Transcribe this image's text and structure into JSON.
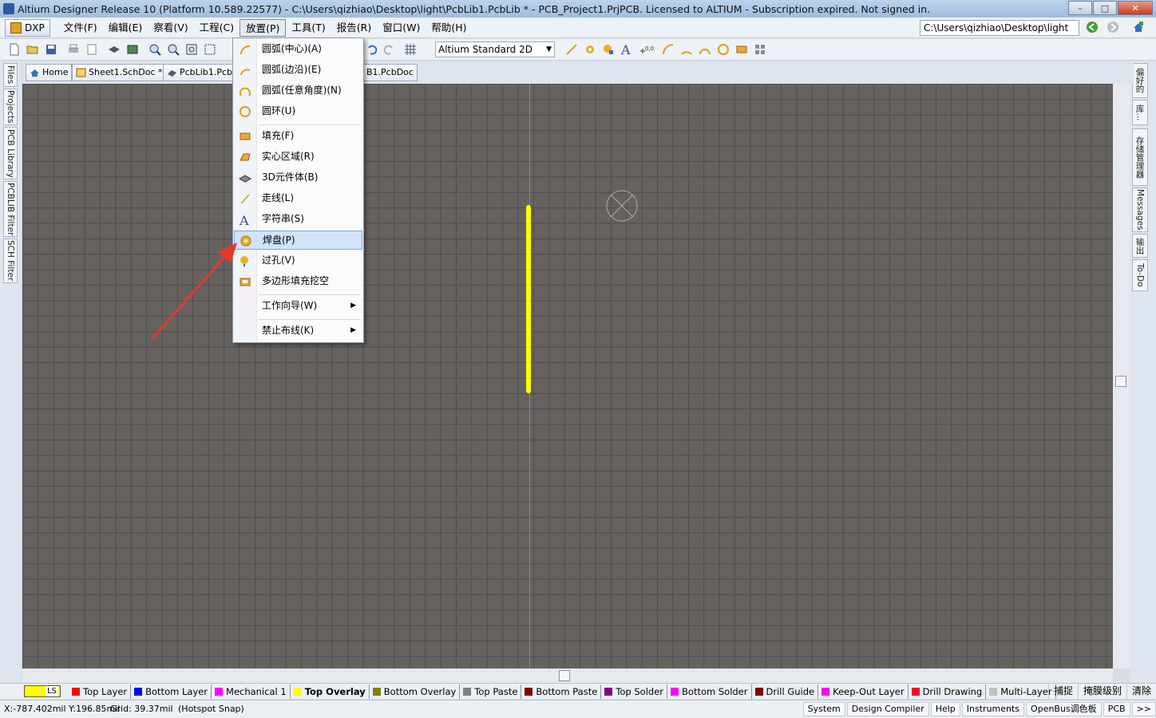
{
  "window": {
    "title": "Altium Designer Release 10 (Platform 10.589.22577) - C:\\Users\\qizhiao\\Desktop\\light\\PcbLib1.PcbLib * - PCB_Project1.PrjPCB. Licensed to ALTIUM - Subscription expired. Not signed in.",
    "minimize": "–",
    "maximize": "□",
    "close": "✕"
  },
  "menubar": {
    "dxp": "DXP",
    "items": [
      "文件(F)",
      "编辑(E)",
      "察看(V)",
      "工程(C)",
      "放置(P)",
      "工具(T)",
      "报告(R)",
      "窗口(W)",
      "帮助(H)"
    ],
    "active_index": 4,
    "path": "C:\\Users\\qizhiao\\Desktop\\light"
  },
  "toolbar": {
    "view_combo": "Altium Standard 2D"
  },
  "doc_tabs": [
    "Home",
    "Sheet1.SchDoc *",
    "PcbLib1.Pcbl",
    "B1.PcbDoc"
  ],
  "left_panels": [
    "Files",
    "Projects",
    "PCB Library",
    "PCBLIB Filter",
    "SCH Filter"
  ],
  "right_panels": [
    "偏好的",
    "库...",
    "存储管理器",
    "Messages",
    "输出",
    "To-Do"
  ],
  "place_menu": {
    "items": [
      {
        "label": "圆弧(中心)(A)",
        "icon": "arc-center-icon"
      },
      {
        "label": "圆弧(边沿)(E)",
        "icon": "arc-edge-icon"
      },
      {
        "label": "圆弧(任意角度)(N)",
        "icon": "arc-any-icon"
      },
      {
        "label": "圆环(U)",
        "icon": "full-circle-icon"
      },
      {
        "label": "填充(F)",
        "icon": "fill-icon"
      },
      {
        "label": "实心区域(R)",
        "icon": "solid-region-icon"
      },
      {
        "label": "3D元件体(B)",
        "icon": "3d-body-icon"
      },
      {
        "label": "走线(L)",
        "icon": "line-icon"
      },
      {
        "label": "字符串(S)",
        "icon": "string-icon"
      },
      {
        "label": "焊盘(P)",
        "icon": "pad-icon"
      },
      {
        "label": "过孔(V)",
        "icon": "via-icon"
      },
      {
        "label": "多边形填充挖空",
        "icon": "polygon-cutout-icon"
      },
      {
        "label": "工作向导(W)",
        "icon": "",
        "submenu": true
      },
      {
        "label": "禁止布线(K)",
        "icon": "",
        "submenu": true
      }
    ],
    "highlighted_index": 9
  },
  "layers": {
    "current": "LS",
    "tabs": [
      {
        "name": "Top Layer",
        "color": "#ff0000"
      },
      {
        "name": "Bottom Layer",
        "color": "#0000ff"
      },
      {
        "name": "Mechanical 1",
        "color": "#ff00ff"
      },
      {
        "name": "Top Overlay",
        "color": "#ffff00",
        "active": true
      },
      {
        "name": "Bottom Overlay",
        "color": "#808000"
      },
      {
        "name": "Top Paste",
        "color": "#808080"
      },
      {
        "name": "Bottom Paste",
        "color": "#800000"
      },
      {
        "name": "Top Solder",
        "color": "#800080"
      },
      {
        "name": "Bottom Solder",
        "color": "#ff00ff"
      },
      {
        "name": "Drill Guide",
        "color": "#800000"
      },
      {
        "name": "Keep-Out Layer",
        "color": "#ff00ff"
      },
      {
        "name": "Drill Drawing",
        "color": "#ff002a"
      },
      {
        "name": "Multi-Layer",
        "color": "#c0c0c0"
      }
    ],
    "right_buttons": [
      "捕捉",
      "掩膜级别",
      "清除"
    ]
  },
  "status": {
    "coords": "X:-787.402mil Y:196.85mil",
    "grid": "Grid: 39.37mil",
    "snap": "(Hotspot Snap)",
    "panels": [
      "System",
      "Design Compiler",
      "Help",
      "Instruments",
      "OpenBus调色板",
      "PCB",
      ">>"
    ]
  }
}
